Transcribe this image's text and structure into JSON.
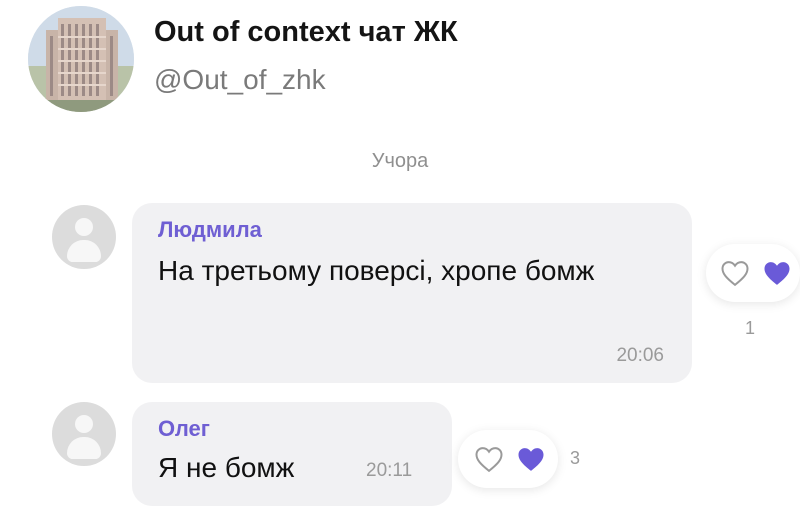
{
  "channel": {
    "title": "Out of context чат ЖК",
    "handle": "@Out_of_zhk"
  },
  "date_separator": "Учора",
  "messages": [
    {
      "sender": "Людмила",
      "text": "На третьому поверсі, хропе бомж",
      "time": "20:06",
      "reaction_count": "1"
    },
    {
      "sender": "Олег",
      "text": "Я не бомж",
      "time": "20:11",
      "reaction_count": "3"
    }
  ],
  "colors": {
    "accent": "#6f5fd3",
    "heart_fill": "#6a5ad8",
    "bubble": "#f1f1f3"
  },
  "icons": {
    "user_placeholder": "user-avatar-icon",
    "reaction_outline": "heart-outline-icon",
    "reaction_filled": "heart-filled-icon"
  }
}
